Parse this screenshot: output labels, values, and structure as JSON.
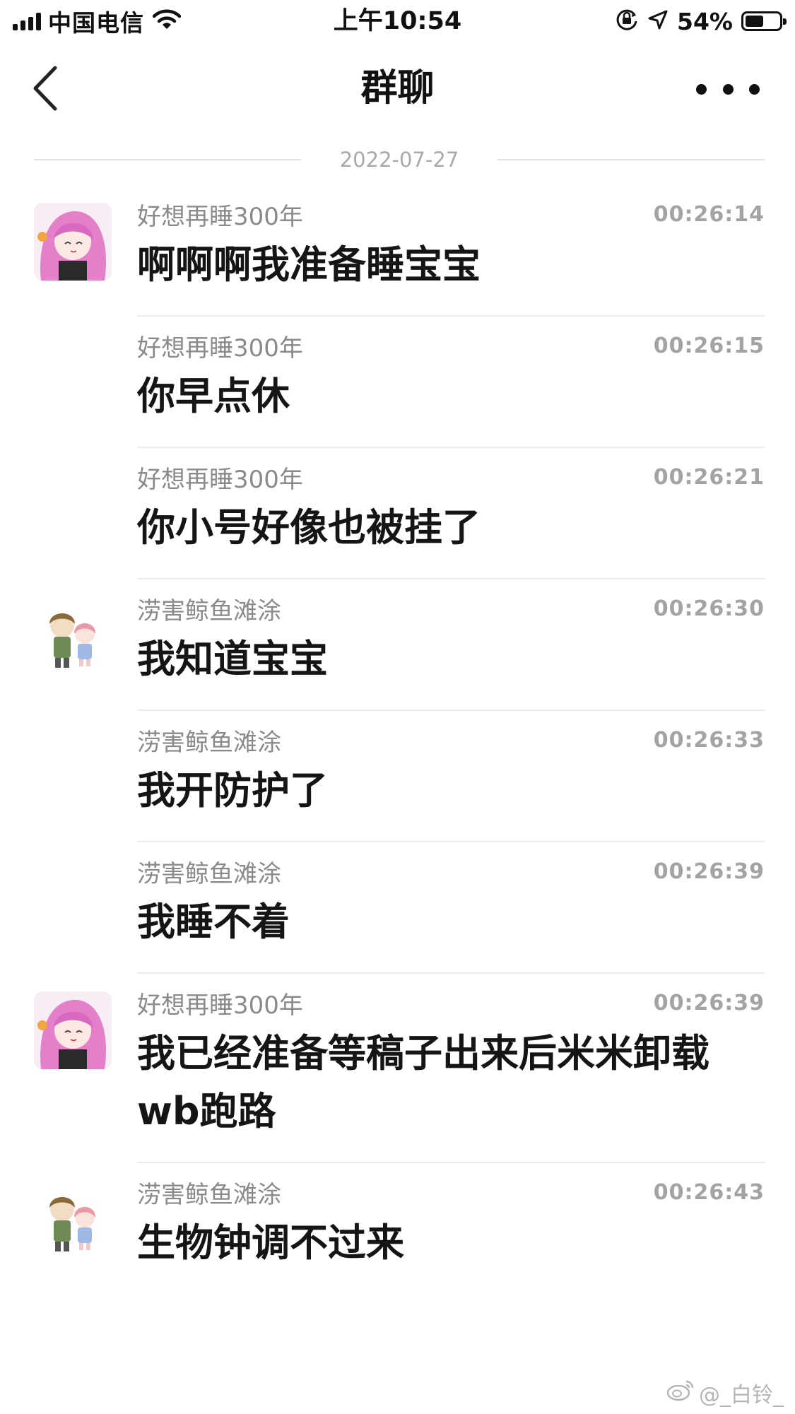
{
  "status_bar": {
    "carrier": "中国电信",
    "time": "上午10:54",
    "battery_percent": "54%",
    "battery_level": 0.54,
    "icons": [
      "signal-icon",
      "wifi-icon",
      "orientation-lock-icon",
      "location-icon",
      "battery-icon"
    ]
  },
  "nav": {
    "title": "群聊",
    "back_icon": "chevron-left-icon",
    "more_icon": "more-icon"
  },
  "date_divider": "2022-07-27",
  "messages": [
    {
      "sender": "好想再睡300年",
      "time": "00:26:14",
      "text": "啊啊啊我准备睡宝宝",
      "avatar": "avatar-pink-girl"
    },
    {
      "sender": "好想再睡300年",
      "time": "00:26:15",
      "text": "你早点休",
      "avatar": null
    },
    {
      "sender": "好想再睡300年",
      "time": "00:26:21",
      "text": "你小号好像也被挂了",
      "avatar": null
    },
    {
      "sender": "涝害鲸鱼滩涂",
      "time": "00:26:30",
      "text": "我知道宝宝",
      "avatar": "avatar-chibi-couple"
    },
    {
      "sender": "涝害鲸鱼滩涂",
      "time": "00:26:33",
      "text": "我开防护了",
      "avatar": null
    },
    {
      "sender": "涝害鲸鱼滩涂",
      "time": "00:26:39",
      "text": "我睡不着",
      "avatar": null
    },
    {
      "sender": "好想再睡300年",
      "time": "00:26:39",
      "text": "我已经准备等稿子出来后米米卸载wb跑路",
      "avatar": "avatar-pink-girl"
    },
    {
      "sender": "涝害鲸鱼滩涂",
      "time": "00:26:43",
      "text": "生物钟调不过来",
      "avatar": "avatar-chibi-couple"
    }
  ],
  "watermark": "@_白铃_",
  "colors": {
    "background": "#ffffff",
    "text_primary": "#151515",
    "text_secondary": "#8a8a8a",
    "timestamp": "#a3a3a3",
    "divider": "#ececec"
  }
}
